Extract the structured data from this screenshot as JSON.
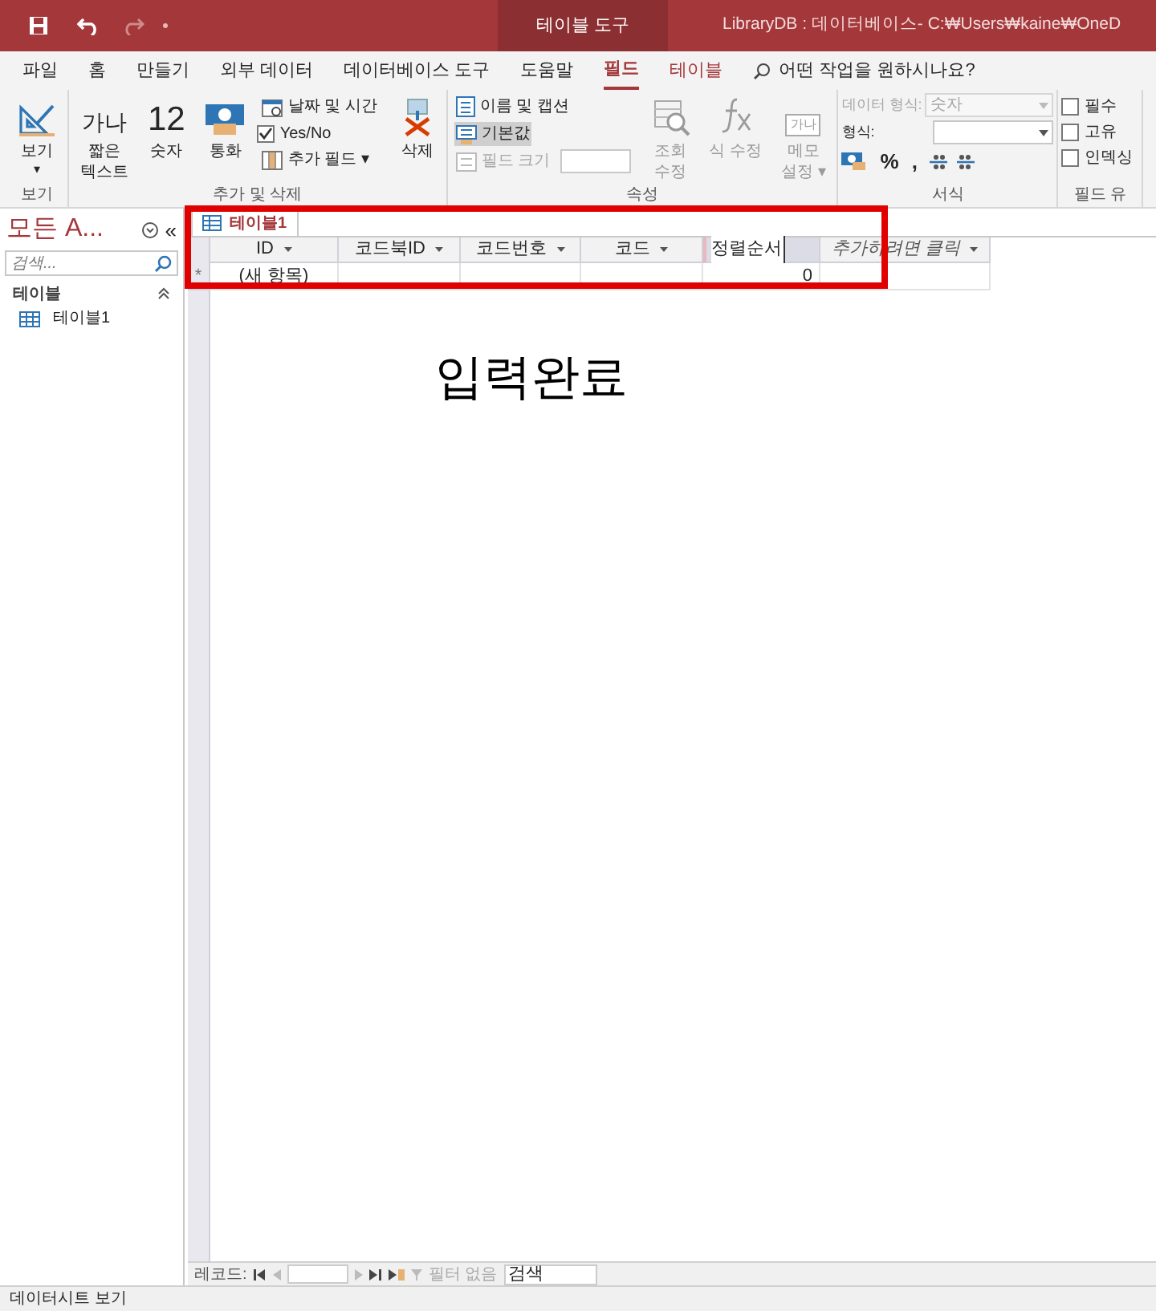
{
  "title_bar": {
    "contextual_tab": "테이블 도구",
    "title": "LibraryDB : 데이터베이스- C:₩Users₩kaine₩OneD"
  },
  "menu_tabs": [
    {
      "label": "파일",
      "selected": false
    },
    {
      "label": "홈",
      "selected": false
    },
    {
      "label": "만들기",
      "selected": false
    },
    {
      "label": "외부 데이터",
      "selected": false
    },
    {
      "label": "데이터베이스 도구",
      "selected": false
    },
    {
      "label": "도움말",
      "selected": false
    },
    {
      "label": "필드",
      "selected": true
    },
    {
      "label": "테이블",
      "selected": false
    }
  ],
  "tell_me": "어떤 작업을 원하시나요?",
  "ribbon_groups": [
    {
      "label": "보기",
      "items": [
        {
          "kind": "large",
          "label": "보기",
          "caret": "▾",
          "disabled": false
        }
      ]
    },
    {
      "label": "추가 및 삭제",
      "items": [
        {
          "kind": "large",
          "glyph": "가나",
          "label": "짧은\n텍스트",
          "disabled": false
        },
        {
          "kind": "large",
          "glyph": "12",
          "label": "숫자",
          "disabled": false
        },
        {
          "kind": "large",
          "label": "통화",
          "disabled": false
        },
        {
          "kind": "stack",
          "rows": [
            {
              "kind": "small",
              "label": "날짜 및 시간",
              "disabled": false,
              "selected": false
            },
            {
              "kind": "check",
              "checked": true,
              "label": "Yes/No"
            },
            {
              "kind": "small",
              "label": "추가 필드 ▾",
              "disabled": false,
              "selected": false
            }
          ]
        },
        {
          "kind": "large",
          "label": "삭제",
          "disabled": false
        }
      ]
    },
    {
      "label": "속성",
      "items": [
        {
          "kind": "stack",
          "rows": [
            {
              "kind": "small",
              "label": "이름 및 캡션",
              "disabled": false,
              "selected": false
            },
            {
              "kind": "small",
              "label": "기본값",
              "disabled": false,
              "selected": true
            },
            {
              "kind": "small",
              "label": "필드 크기",
              "disabled": true,
              "selected": false
            }
          ]
        },
        {
          "kind": "large",
          "label": "조회\n수정",
          "disabled": true
        },
        {
          "kind": "large",
          "label": "식 수정",
          "disabled": true
        },
        {
          "kind": "large",
          "glyph": "가나",
          "label": "메모\n설정 ▾",
          "disabled": true
        }
      ]
    },
    {
      "label": "서식",
      "items": [
        {
          "kind": "format",
          "data_type_label": "데이터 형식:",
          "data_type_value": "숫자",
          "format_label": "형식:",
          "data_type_disabled": true,
          "symbols": [
            "%",
            ","
          ]
        }
      ]
    },
    {
      "label": "필드 유",
      "items": [
        {
          "kind": "stack",
          "rows": [
            {
              "kind": "check",
              "checked": false,
              "label": "필수"
            },
            {
              "kind": "check",
              "checked": false,
              "label": "고유"
            },
            {
              "kind": "check",
              "checked": false,
              "label": "인덱싱"
            }
          ]
        }
      ]
    }
  ],
  "nav_pane": {
    "title": "모든 A...",
    "collapse": "«",
    "search_placeholder": "검색...",
    "sections": [
      {
        "label": "테이블",
        "expanded": true,
        "items": [
          {
            "label": "테이블1",
            "selected": false
          }
        ]
      }
    ]
  },
  "document_tabs": [
    {
      "label": "테이블1",
      "selected": true
    }
  ],
  "table": {
    "columns": [
      {
        "label": "ID",
        "selected": false,
        "italic": false,
        "dropdown": true
      },
      {
        "label": "코드북ID",
        "selected": false,
        "italic": false,
        "dropdown": true
      },
      {
        "label": "코드번호",
        "selected": false,
        "italic": false,
        "dropdown": true
      },
      {
        "label": "코드",
        "selected": false,
        "italic": false,
        "dropdown": true
      },
      {
        "label": "정렬순서",
        "selected": true,
        "italic": false,
        "dropdown": false
      },
      {
        "label": "추가하려면 클릭",
        "selected": false,
        "italic": true,
        "dropdown": true
      }
    ],
    "rows": [
      {
        "marker": "*",
        "cells": [
          "(새 항목)",
          "",
          "",
          "",
          "0",
          ""
        ]
      }
    ]
  },
  "annotation": {
    "label": "입력완료"
  },
  "record_nav": {
    "label": "레코드:",
    "filter": "필터 없음",
    "search": "검색"
  },
  "status_bar": "데이터시트 보기"
}
